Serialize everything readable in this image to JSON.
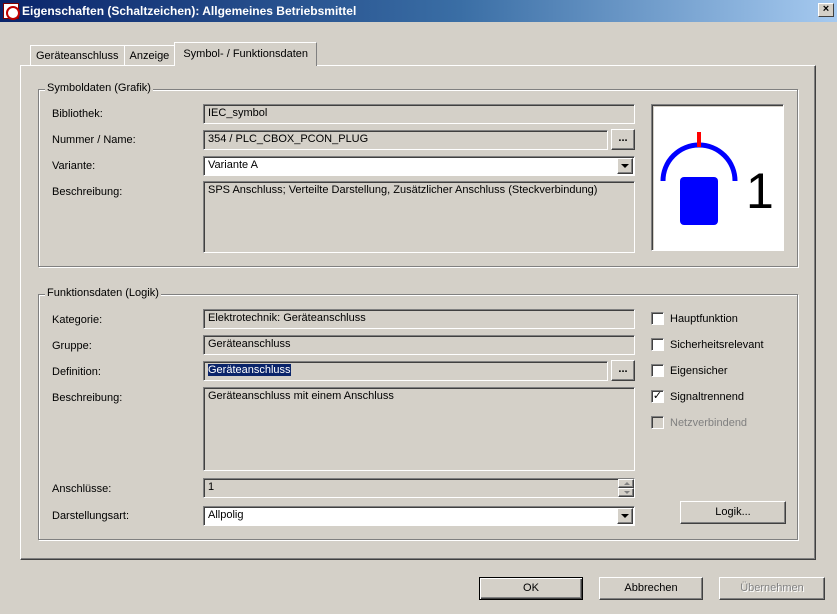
{
  "window": {
    "title": "Eigenschaften (Schaltzeichen): Allgemeines Betriebsmittel",
    "close_label": "×"
  },
  "tabs": [
    {
      "label": "Geräteanschluss",
      "active": false
    },
    {
      "label": "Anzeige",
      "active": false
    },
    {
      "label": "Symbol- / Funktionsdaten",
      "active": true
    }
  ],
  "symbol_group": {
    "legend": "Symboldaten (Grafik)",
    "bibliothek_label": "Bibliothek:",
    "bibliothek_value": "IEC_symbol",
    "nummer_label": "Nummer / Name:",
    "nummer_value": "354 / PLC_CBOX_PCON_PLUG",
    "browse_label": "...",
    "variante_label": "Variante:",
    "variante_value": "Variante A",
    "beschreibung_label": "Beschreibung:",
    "beschreibung_value": "SPS Anschluss; Verteilte Darstellung, Zusätzlicher Anschluss (Steckverbindung)",
    "preview_number": "1",
    "preview_colors": {
      "arc": "#0000ff",
      "pin": "#ff0000",
      "body": "#0000ff"
    }
  },
  "function_group": {
    "legend": "Funktionsdaten (Logik)",
    "kategorie_label": "Kategorie:",
    "kategorie_value": "Elektrotechnik: Geräteanschluss",
    "gruppe_label": "Gruppe:",
    "gruppe_value": "Geräteanschluss",
    "definition_label": "Definition:",
    "definition_value": "Geräteanschluss",
    "browse_label": "...",
    "beschreibung_label": "Beschreibung:",
    "beschreibung_value": "Geräteanschluss mit einem Anschluss",
    "anschluesse_label": "Anschlüsse:",
    "anschluesse_value": "1",
    "darstellungsart_label": "Darstellungsart:",
    "darstellungsart_value": "Allpolig",
    "checkboxes": [
      {
        "label": "Hauptfunktion",
        "checked": false,
        "enabled": true
      },
      {
        "label": "Sicherheitsrelevant",
        "checked": false,
        "enabled": true
      },
      {
        "label": "Eigensicher",
        "checked": false,
        "enabled": true
      },
      {
        "label": "Signaltrennend",
        "checked": true,
        "enabled": true
      },
      {
        "label": "Netzverbindend",
        "checked": false,
        "enabled": false
      }
    ],
    "logik_button": "Logik..."
  },
  "footer": {
    "ok": "OK",
    "cancel": "Abbrechen",
    "apply": "Übernehmen"
  }
}
